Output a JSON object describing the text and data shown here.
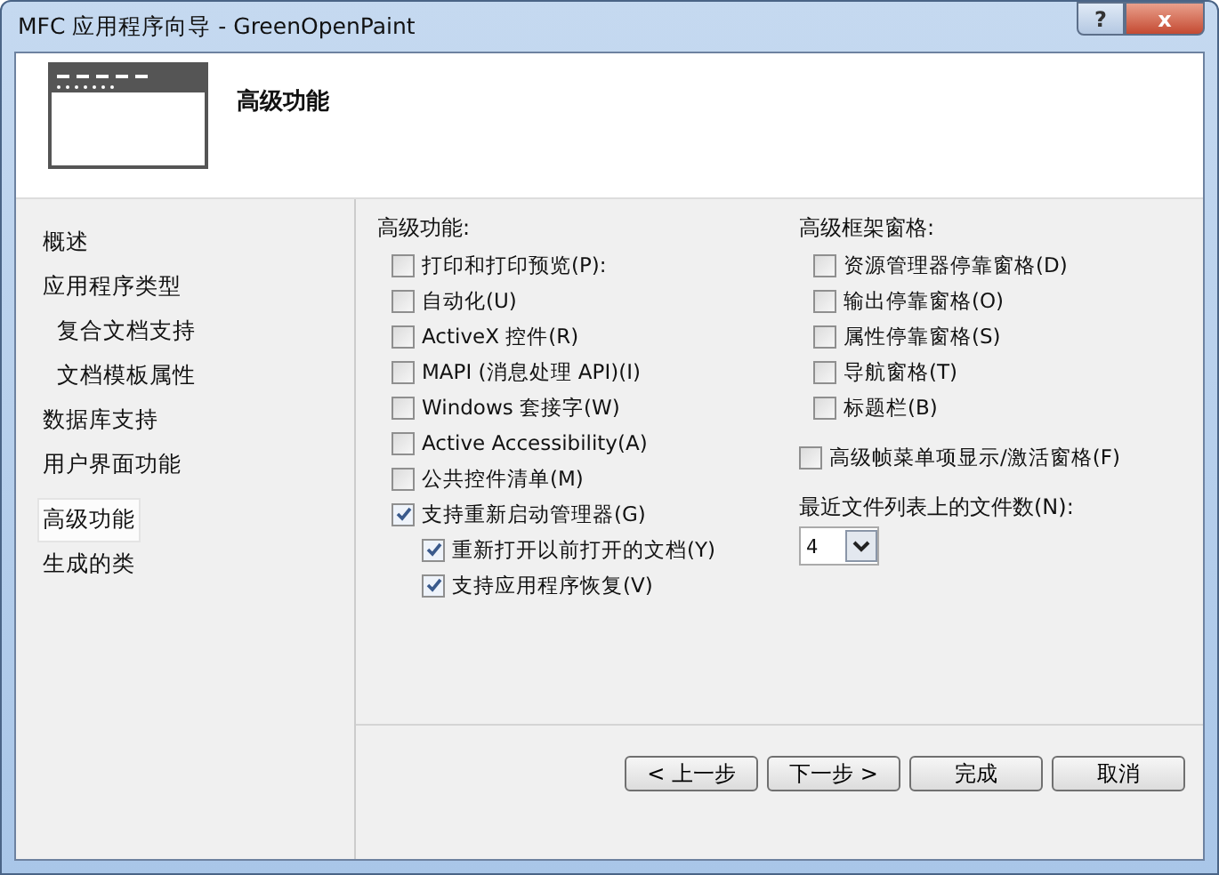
{
  "window": {
    "title": "MFC 应用程序向导 - GreenOpenPaint",
    "help_button": "?",
    "close_button": "x"
  },
  "header": {
    "title": "高级功能"
  },
  "nav": [
    {
      "label": "概述",
      "selected": false
    },
    {
      "label": "应用程序类型",
      "selected": false,
      "children": [
        {
          "label": "复合文档支持",
          "selected": false
        },
        {
          "label": "文档模板属性",
          "selected": false
        }
      ]
    },
    {
      "label": "数据库支持",
      "selected": false
    },
    {
      "label": "用户界面功能",
      "selected": false
    },
    {
      "label": "高级功能",
      "selected": true
    },
    {
      "label": "生成的类",
      "selected": false
    }
  ],
  "features": {
    "label": "高级功能:",
    "options": [
      {
        "label": "打印和打印预览(P):",
        "checked": false
      },
      {
        "label": "自动化(U)",
        "checked": false
      },
      {
        "label": "ActiveX 控件(R)",
        "checked": false
      },
      {
        "label": "MAPI (消息处理 API)(I)",
        "checked": false
      },
      {
        "label": "Windows 套接字(W)",
        "checked": false
      },
      {
        "label": "Active Accessibility(A)",
        "checked": false
      },
      {
        "label": "公共控件清单(M)",
        "checked": false
      },
      {
        "label": "支持重新启动管理器(G)",
        "checked": true,
        "children": [
          {
            "label": "重新打开以前打开的文档(Y)",
            "checked": true
          },
          {
            "label": "支持应用程序恢复(V)",
            "checked": true
          }
        ]
      }
    ]
  },
  "frame_panes": {
    "label": "高级框架窗格:",
    "options": [
      {
        "label": "资源管理器停靠窗格(D)",
        "checked": false
      },
      {
        "label": "输出停靠窗格(O)",
        "checked": false
      },
      {
        "label": "属性停靠窗格(S)",
        "checked": false
      },
      {
        "label": "导航窗格(T)",
        "checked": false
      },
      {
        "label": "标题栏(B)",
        "checked": false
      }
    ]
  },
  "menu_option": {
    "label": "高级帧菜单项显示/激活窗格(F)",
    "checked": false
  },
  "recent_files": {
    "label": "最近文件列表上的文件数(N):",
    "value": "4"
  },
  "buttons": [
    "< 上一步",
    "下一步 >",
    "完成",
    "取消"
  ]
}
